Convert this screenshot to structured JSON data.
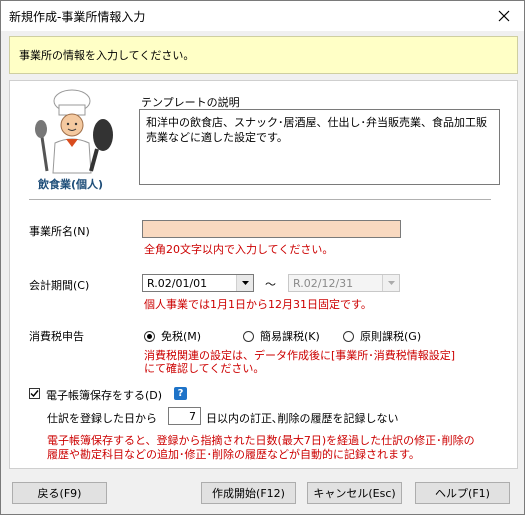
{
  "window": {
    "title": "新規作成-事業所情報入力",
    "close_icon": "close-icon"
  },
  "banner": {
    "text": "事業所の情報を入力してください。"
  },
  "template": {
    "business_type": "飲食業(個人)",
    "description_label": "テンプレートの説明",
    "description": "和洋中の飲食店、スナック･居酒屋、仕出し･弁当販売業、食品加工販売業などに適した設定です。"
  },
  "office": {
    "label": "事業所名(N)",
    "value": "",
    "note": "全角20文字以内で入力してください。"
  },
  "period": {
    "label": "会計期間(C)",
    "start": "R.02/01/01",
    "separator": "〜",
    "end": "R.02/12/31",
    "note": "個人事業では1月1日から12月31日固定です。"
  },
  "tax": {
    "label": "消費税申告",
    "options": [
      "免税(M)",
      "簡易課税(K)",
      "原則課税(G)"
    ],
    "selected": "免税(M)",
    "note_line1": "消費税関連の設定は、データ作成後に[事業所･消費税情報設定]",
    "note_line2": "にて確認してください。"
  },
  "ebook": {
    "checkbox_label": "電子帳簿保存をする(D)",
    "checked": true,
    "help_icon": "?",
    "days_prefix": "仕訳を登録した日から",
    "days": "7",
    "days_suffix": "日以内の訂正､削除の履歴を記録しない",
    "note_line1": "電子帳簿保存すると、登録から指摘された日数(最大7日)を経過した仕訳の修正･削除の",
    "note_line2": "履歴や勘定科目などの追加･修正･削除の履歴などが自動的に記録されます。"
  },
  "buttons": {
    "back": "戻る(F9)",
    "create": "作成開始(F12)",
    "cancel": "キャンセル(Esc)",
    "help": "ヘルプ(F1)"
  }
}
